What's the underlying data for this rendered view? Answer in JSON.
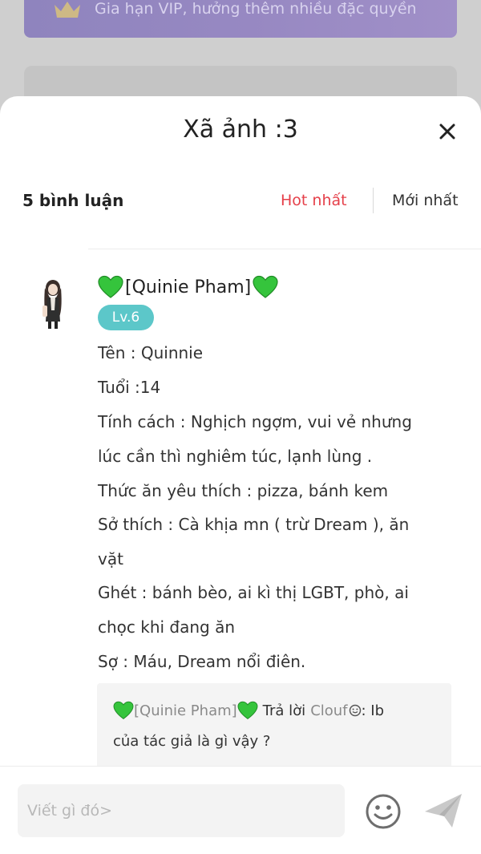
{
  "background": {
    "vip_banner_text": "Gia hạn VIP, hưởng thêm nhiều đặc quyền"
  },
  "sheet": {
    "title": "Xã ảnh :3",
    "close_icon": "close-icon"
  },
  "comments_header": {
    "count_label": "5 bình luận",
    "sort_hot": "Hot nhất",
    "sort_new": "Mới nhất",
    "active_sort_color": "#e5404a"
  },
  "comment": {
    "user_name": "[Quinie Pham]",
    "level": "Lv.6",
    "level_color": "#5cc7c9",
    "lines": [
      "Tên : Quinnie",
      "Tuổi :14",
      "Tính cách : Nghịch ngợm, vui vẻ nhưng",
      "lúc      cần thì nghiêm túc, lạnh lùng .",
      "Thức ăn yêu thích : pizza, bánh kem",
      "Sở thích : Cà khịa mn ( trừ Dream ), ăn",
      "vặt",
      "Ghét : bánh bèo, ai kì thị LGBT, phò, ai",
      "chọc khi đang ăn",
      "Sợ : Máu, Dream nổi điên."
    ],
    "reply": {
      "from": "[Quinie Pham]",
      "verb": "Trả lời",
      "to": "Clouf",
      "text_line1": ": Ib",
      "text_line2": "của tác giả là gì vậy ?"
    }
  },
  "input": {
    "placeholder": "Viết gì đó>",
    "emoji_icon": "smiley-icon",
    "send_icon": "send-icon"
  }
}
